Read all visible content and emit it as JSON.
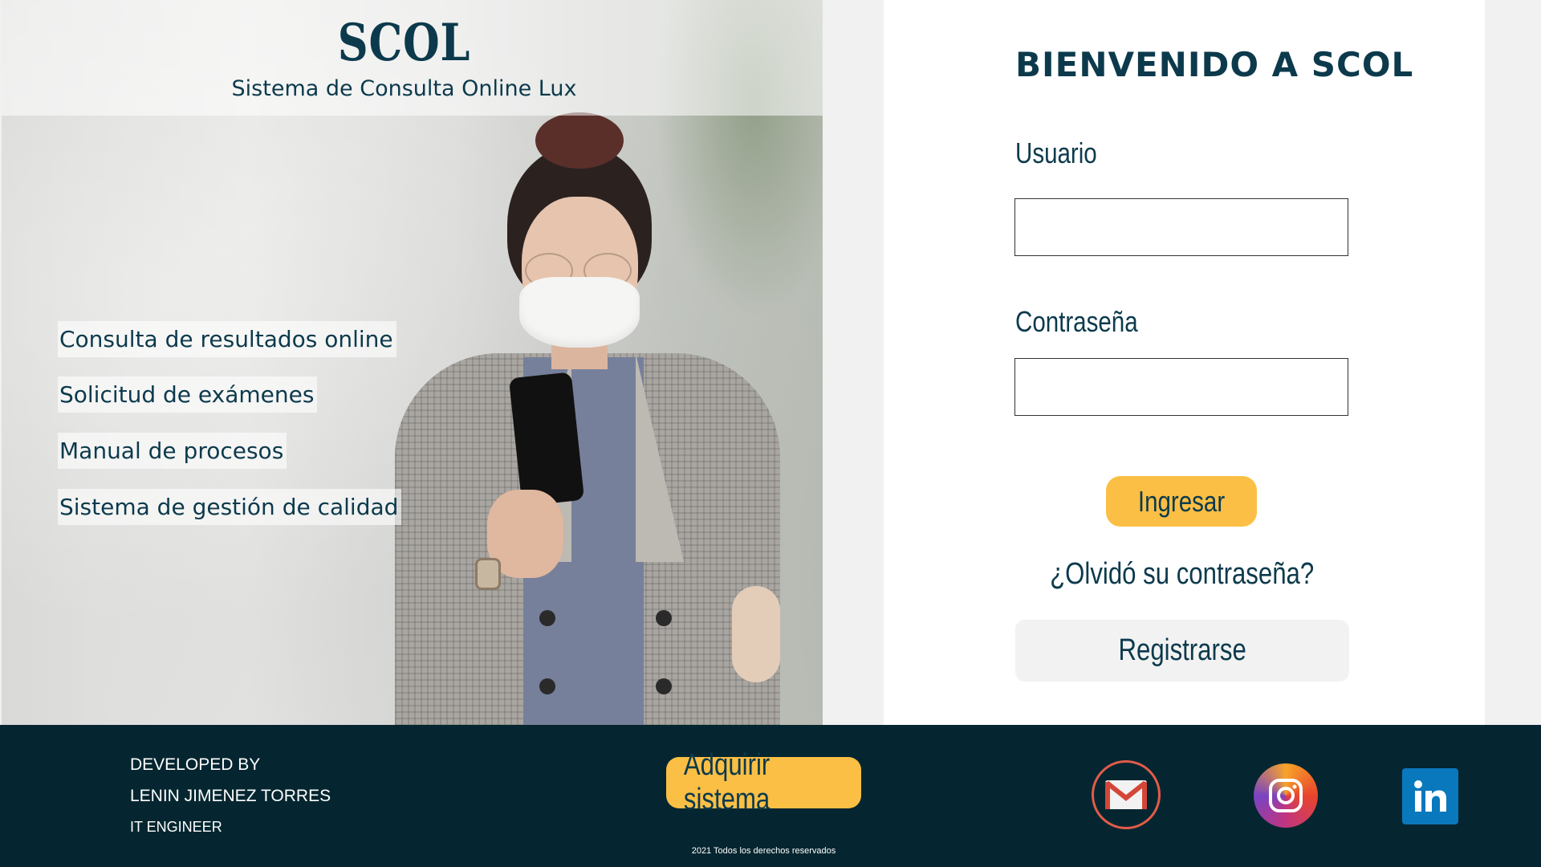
{
  "hero": {
    "title": "SCOL",
    "subtitle": "Sistema de Consulta Online Lux",
    "features": [
      "Consulta de resultados online",
      "Solicitud de exámenes",
      "Manual de procesos",
      "Sistema de gestión de calidad"
    ]
  },
  "login": {
    "welcome": "BIENVENIDO A SCOL",
    "username_label": "Usuario",
    "username_value": "",
    "password_label": "Contraseña",
    "password_value": "",
    "login_button": "Ingresar",
    "forgot_link": "¿Olvidó su contraseña?",
    "register_button": "Registrarse"
  },
  "footer": {
    "developed_by": "DEVELOPED BY",
    "developer_name": "LENIN JIMENEZ TORRES",
    "developer_role": "IT ENGINEER",
    "buy_button": "Adquirir sistema",
    "copyright": "2021 Todos los derechos reservados",
    "social": [
      "gmail-icon",
      "instagram-icon",
      "linkedin-icon"
    ]
  },
  "colors": {
    "primary": "#0c3a4c",
    "accent": "#fbbf45",
    "footer_bg": "#052630",
    "panel_bg": "#ffffff",
    "page_bg": "#f1f1f1"
  }
}
